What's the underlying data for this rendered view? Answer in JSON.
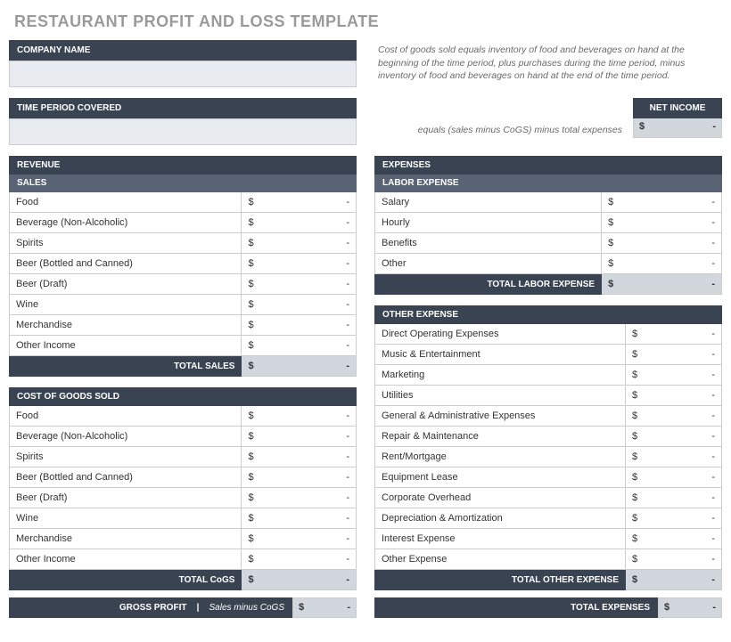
{
  "title": "RESTAURANT PROFIT AND LOSS TEMPLATE",
  "company_name_label": "COMPANY NAME",
  "time_period_label": "TIME PERIOD COVERED",
  "cogs_note": "Cost of goods sold equals inventory of food and beverages on hand at the beginning of the time period, plus purchases during the time period, minus inventory of food and beverages on hand at the end of the time period.",
  "net_income": {
    "label": "NET INCOME",
    "eq_note": "equals (sales minus CoGS) minus total expenses",
    "currency": "$",
    "value": "-"
  },
  "revenue": {
    "header": "REVENUE",
    "sales_header": "SALES",
    "items": [
      {
        "label": "Food",
        "currency": "$",
        "value": "-"
      },
      {
        "label": "Beverage (Non-Alcoholic)",
        "currency": "$",
        "value": "-"
      },
      {
        "label": "Spirits",
        "currency": "$",
        "value": "-"
      },
      {
        "label": "Beer (Bottled and Canned)",
        "currency": "$",
        "value": "-"
      },
      {
        "label": "Beer (Draft)",
        "currency": "$",
        "value": "-"
      },
      {
        "label": "Wine",
        "currency": "$",
        "value": "-"
      },
      {
        "label": "Merchandise",
        "currency": "$",
        "value": "-"
      },
      {
        "label": "Other  Income",
        "currency": "$",
        "value": "-"
      }
    ],
    "total_label": "TOTAL SALES",
    "total_currency": "$",
    "total_value": "-"
  },
  "cogs": {
    "header": "COST OF GOODS SOLD",
    "items": [
      {
        "label": "Food",
        "currency": "$",
        "value": "-"
      },
      {
        "label": "Beverage (Non-Alcoholic)",
        "currency": "$",
        "value": "-"
      },
      {
        "label": "Spirits",
        "currency": "$",
        "value": "-"
      },
      {
        "label": "Beer (Bottled and Canned)",
        "currency": "$",
        "value": "-"
      },
      {
        "label": "Beer (Draft)",
        "currency": "$",
        "value": "-"
      },
      {
        "label": "Wine",
        "currency": "$",
        "value": "-"
      },
      {
        "label": "Merchandise",
        "currency": "$",
        "value": "-"
      },
      {
        "label": "Other  Income",
        "currency": "$",
        "value": "-"
      }
    ],
    "total_label": "TOTAL CoGS",
    "total_currency": "$",
    "total_value": "-"
  },
  "gross_profit": {
    "label": "GROSS PROFIT",
    "sep": "|",
    "sub": "Sales minus CoGS",
    "currency": "$",
    "value": "-"
  },
  "expenses": {
    "header": "EXPENSES",
    "labor": {
      "header": "LABOR EXPENSE",
      "items": [
        {
          "label": "Salary",
          "currency": "$",
          "value": "-"
        },
        {
          "label": "Hourly",
          "currency": "$",
          "value": "-"
        },
        {
          "label": "Benefits",
          "currency": "$",
          "value": "-"
        },
        {
          "label": "Other",
          "currency": "$",
          "value": "-"
        }
      ],
      "total_label": "TOTAL LABOR EXPENSE",
      "total_currency": "$",
      "total_value": "-"
    },
    "other": {
      "header": "OTHER EXPENSE",
      "items": [
        {
          "label": "Direct Operating Expenses",
          "currency": "$",
          "value": "-"
        },
        {
          "label": "Music & Entertainment",
          "currency": "$",
          "value": "-"
        },
        {
          "label": "Marketing",
          "currency": "$",
          "value": "-"
        },
        {
          "label": "Utilities",
          "currency": "$",
          "value": "-"
        },
        {
          "label": "General & Administrative Expenses",
          "currency": "$",
          "value": "-"
        },
        {
          "label": "Repair & Maintenance",
          "currency": "$",
          "value": "-"
        },
        {
          "label": "Rent/Mortgage",
          "currency": "$",
          "value": "-"
        },
        {
          "label": "Equipment Lease",
          "currency": "$",
          "value": "-"
        },
        {
          "label": "Corporate Overhead",
          "currency": "$",
          "value": "-"
        },
        {
          "label": "Depreciation & Amortization",
          "currency": "$",
          "value": "-"
        },
        {
          "label": "Interest Expense",
          "currency": "$",
          "value": "-"
        },
        {
          "label": "Other Expense",
          "currency": "$",
          "value": "-"
        }
      ],
      "total_label": "TOTAL OTHER EXPENSE",
      "total_currency": "$",
      "total_value": "-"
    },
    "total_label": "TOTAL EXPENSES",
    "total_currency": "$",
    "total_value": "-"
  }
}
